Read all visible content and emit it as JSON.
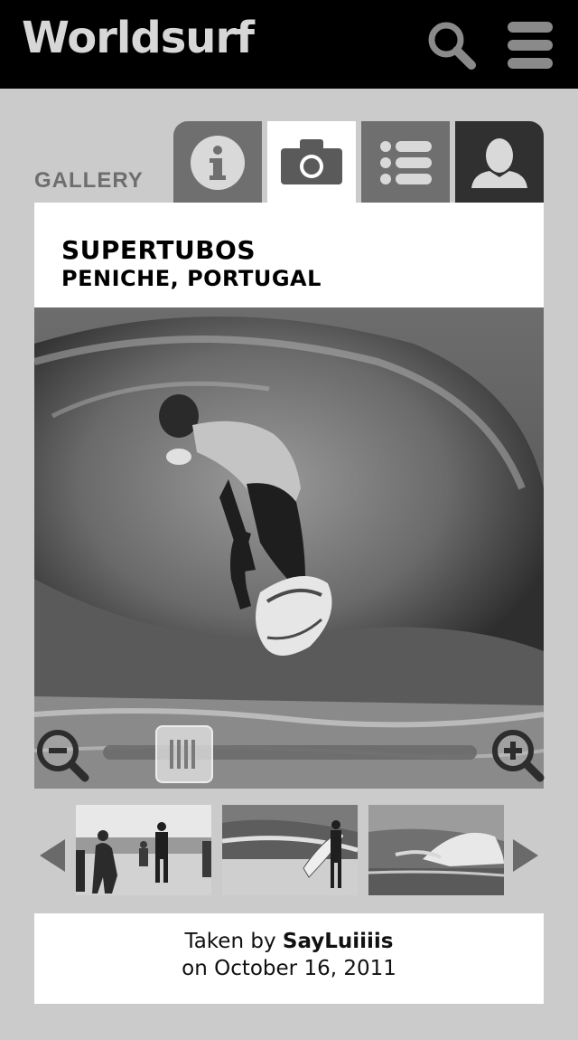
{
  "app": {
    "title": "Worldsurf"
  },
  "header": {
    "search_icon": "search-icon",
    "menu_icon": "hamburger-menu-icon"
  },
  "section": {
    "label": "GALLERY"
  },
  "tabs": [
    {
      "id": "info",
      "icon": "info-icon",
      "active": false
    },
    {
      "id": "gallery",
      "icon": "camera-icon",
      "active": true
    },
    {
      "id": "list",
      "icon": "list-icon",
      "active": false
    },
    {
      "id": "profile",
      "icon": "user-icon",
      "active": false
    }
  ],
  "spot": {
    "name": "SUPERTUBOS",
    "location": "PENICHE, PORTUGAL"
  },
  "zoom": {
    "level": 0.2
  },
  "thumbnails": {
    "prev_icon": "arrow-left-icon",
    "next_icon": "arrow-right-icon",
    "items": [
      {
        "subject": "people-on-beach-photo"
      },
      {
        "subject": "surfer-with-board-photo"
      },
      {
        "subject": "breaking-wave-photo"
      }
    ]
  },
  "caption": {
    "prefix": "Taken by ",
    "author": "SayLuiiiis",
    "date_line": "on October 16, 2011"
  },
  "colors": {
    "topbar": "#000000",
    "background": "#cbcbcb",
    "tab_inactive": "#6f6f6f",
    "tab_profile": "#303030"
  }
}
